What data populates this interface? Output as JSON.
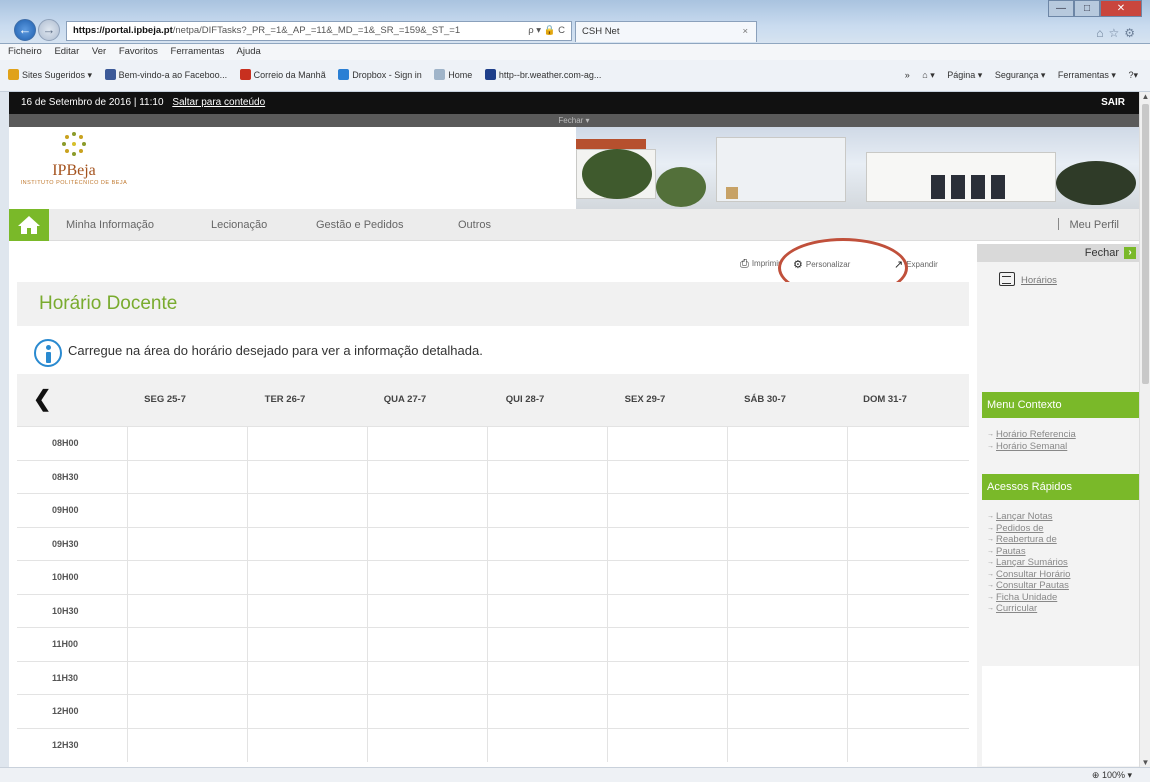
{
  "browser": {
    "address_domain": "https://portal.ipbeja.pt",
    "address_rest": "/netpa/DIFTasks?_PR_=1&_AP_=11&_MD_=1&_SR_=159&_ST_=1",
    "address_tools": "ρ ▾ 🔒 C",
    "tab_title": "CSH Net",
    "tab_close": "×",
    "menu": [
      "Ficheiro",
      "Editar",
      "Ver",
      "Favoritos",
      "Ferramentas",
      "Ajuda"
    ],
    "favorites": [
      "Sites Sugeridos ▾",
      "Bem-vindo-a ao Faceboo...",
      "Correio da Manhã",
      "Dropbox - Sign in",
      "Home",
      "http--br.weather.com-ag..."
    ],
    "favorites_right": [
      "»",
      "⌂ ▾",
      "Página ▾",
      "Segurança ▾",
      "Ferramentas ▾",
      "?▾"
    ],
    "status_zoom": "100%"
  },
  "page": {
    "date_time": "16 de Setembro de 2016 | 11:10",
    "skip_link": "Saltar para conteúdo",
    "logout": "SAIR",
    "collapse_header": "Fechar ▾",
    "logo_name": "IPBeja",
    "logo_sub": "INSTITUTO POLITÉCNICO DE BEJA",
    "nav": [
      "Minha Informação",
      "Lecionação",
      "Gestão e Pedidos",
      "Outros"
    ],
    "profile": "Meu Perfil",
    "tools": {
      "print": "Imprimir",
      "customize": "Personalizar",
      "expand": "Expandir"
    },
    "title": "Horário Docente",
    "info": "Carregue na área do horário desejado para ver a informação detalhada.",
    "days": [
      "SEG 25-7",
      "TER 26-7",
      "QUA 27-7",
      "QUI 28-7",
      "SEX 29-7",
      "SÁB 30-7",
      "DOM 31-7"
    ],
    "times": [
      "08H00",
      "08H30",
      "09H00",
      "09H30",
      "10H00",
      "10H30",
      "11H00",
      "11H30",
      "12H00",
      "12H30"
    ]
  },
  "side_panel": {
    "close_label": "Fechar",
    "horarios": "Horários",
    "menu_contexto_title": "Menu Contexto",
    "menu_contexto": [
      "Horário Referencia",
      "Horário Semanal"
    ],
    "acessos_title": "Acessos Rápidos",
    "acessos": [
      "Lançar Notas",
      "Pedidos de",
      "Reabertura de",
      "Pautas",
      "Lançar Sumários",
      "Consultar Horário",
      "Consultar Pautas",
      "Ficha Unidade",
      "Curricular"
    ]
  },
  "colors": {
    "accent_green": "#7ab929",
    "title_green": "#79ab2e",
    "highlight_red": "#c0503b"
  }
}
